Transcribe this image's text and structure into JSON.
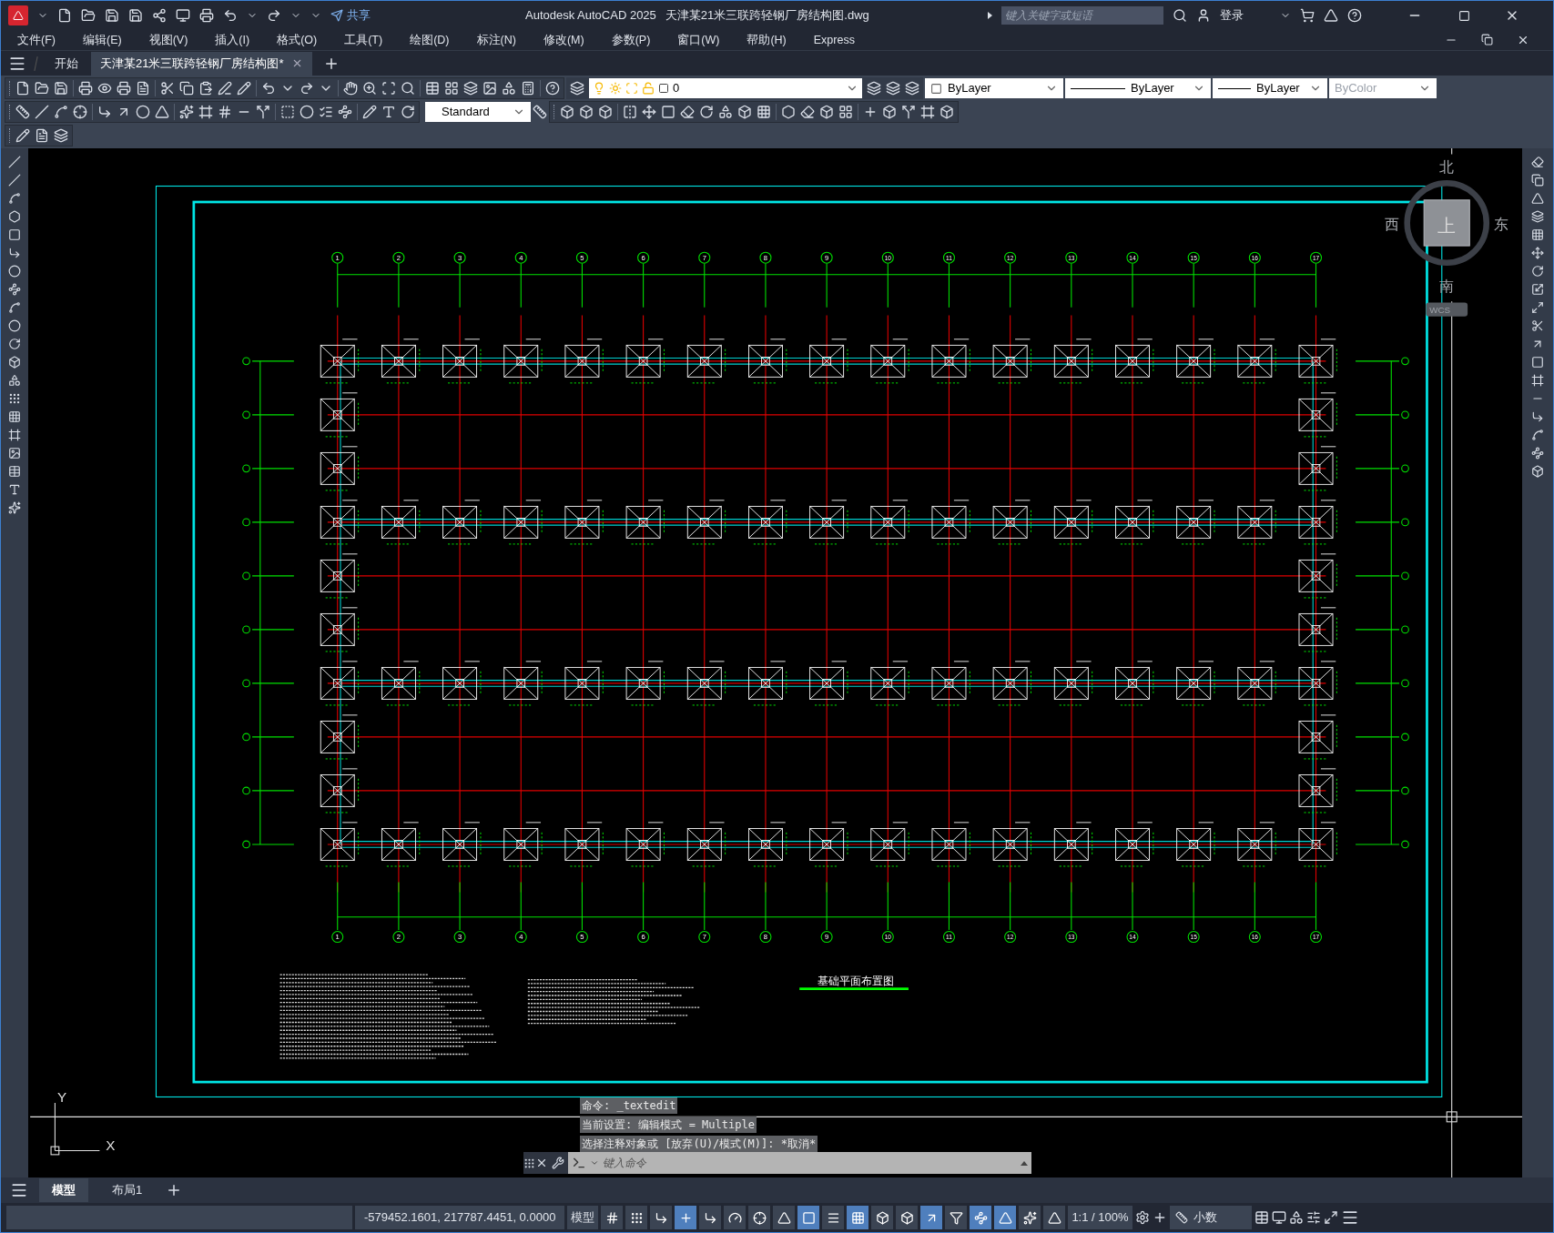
{
  "title_bar": {
    "share": "共享",
    "app_title": "Autodesk AutoCAD 2025",
    "file_name": "天津某21米三联跨轻钢厂房结构图.dwg",
    "search": {
      "placeholder": "键入关键字或短语"
    },
    "sign_in": "登录"
  },
  "menu": [
    "文件(F)",
    "编辑(E)",
    "视图(V)",
    "插入(I)",
    "格式(O)",
    "工具(T)",
    "绘图(D)",
    "标注(N)",
    "修改(M)",
    "参数(P)",
    "窗口(W)",
    "帮助(H)",
    "Express"
  ],
  "document_tabs": [
    {
      "label": "开始",
      "selected": false
    },
    {
      "label": "天津某21米三联跨轻钢厂房结构图*",
      "selected": true
    }
  ],
  "properties_toolbar": {
    "layer": "0",
    "object_color": "ByLayer",
    "linetype": "ByLayer",
    "lineweight": "ByLayer",
    "plot_style": "ByColor"
  },
  "text_style": "Standard",
  "drawing": {
    "title": "基础平面布置图",
    "top_axis_labels": [
      "1",
      "2",
      "3",
      "4",
      "5",
      "6",
      "7",
      "8",
      "9",
      "10",
      "11",
      "12",
      "13",
      "14",
      "15",
      "16",
      "17"
    ],
    "bottom_axis_labels": [
      "1",
      "2",
      "3",
      "4",
      "5",
      "6",
      "7",
      "8",
      "9",
      "10",
      "11",
      "12",
      "13",
      "14",
      "15",
      "16",
      "17"
    ]
  },
  "view_cube": {
    "north": "北",
    "south": "南",
    "east": "东",
    "west": "西",
    "face": "上",
    "ucs": "WCS"
  },
  "ucs_icon": {
    "x": "X",
    "y": "Y"
  },
  "command_history": [
    "命令: _textedit",
    "当前设置: 编辑模式 = Multiple",
    "选择注释对象或 [放弃(U)/模式(M)]: *取消*"
  ],
  "command_line": {
    "placeholder": "键入命令"
  },
  "layout_tabs": [
    {
      "label": "模型",
      "selected": true
    },
    {
      "label": "布局1",
      "selected": false
    }
  ],
  "status_bar": {
    "coordinates": "-579452.1601, 217787.4451, 0.0000",
    "space": "模型",
    "scale": "1:1 / 100%",
    "units": "小数",
    "toggles": [
      {
        "on": false
      },
      {
        "on": false
      },
      {
        "on": false
      },
      {
        "on": true
      },
      {
        "on": false
      },
      {
        "on": false
      },
      {
        "on": false
      },
      {
        "on": false
      },
      {
        "on": true
      },
      {
        "on": false
      },
      {
        "on": true
      },
      {
        "on": false
      },
      {
        "on": false
      },
      {
        "on": true
      },
      {
        "on": false
      },
      {
        "on": true
      },
      {
        "on": true
      },
      {
        "on": false
      },
      {
        "on": false
      }
    ]
  }
}
